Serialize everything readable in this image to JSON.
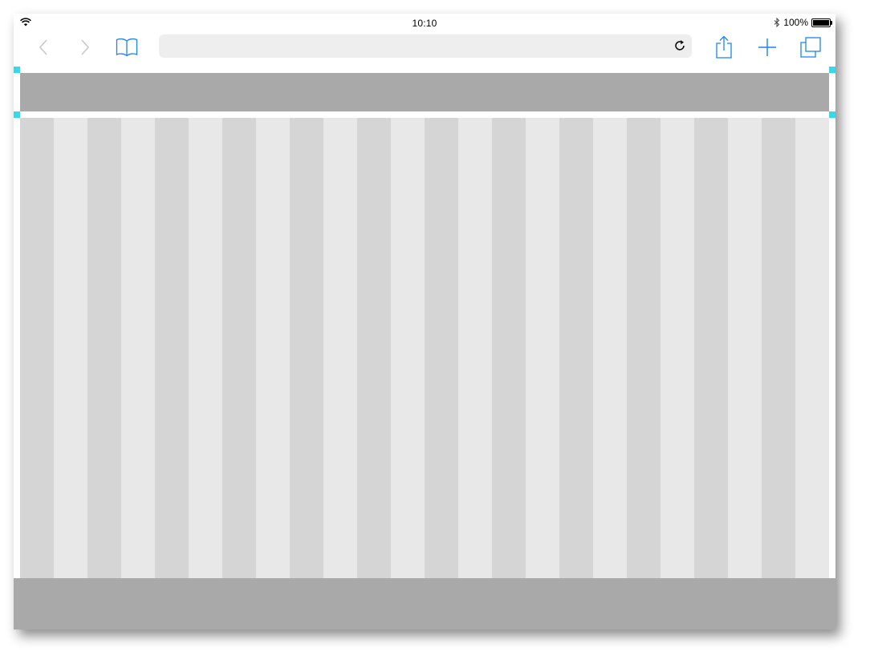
{
  "status_bar": {
    "time": "10:10",
    "battery_percent": "100%",
    "battery_level": 1.0,
    "icons": [
      "wifi-icon",
      "bluetooth-icon",
      "battery-icon"
    ]
  },
  "toolbar": {
    "url_value": "",
    "icons": [
      "back-icon",
      "forward-icon",
      "bookmarks-icon",
      "reload-icon",
      "share-icon",
      "new-tab-icon",
      "tabs-icon"
    ]
  },
  "page": {
    "grid_columns": 24,
    "colors": {
      "accent": "#1a82fb",
      "disabled": "#c7c7cc",
      "band": "#a9a9aa",
      "column_dark": "#d5d5d5",
      "column_light": "#e8e8e8",
      "selection_handle": "#35d9e8"
    }
  }
}
